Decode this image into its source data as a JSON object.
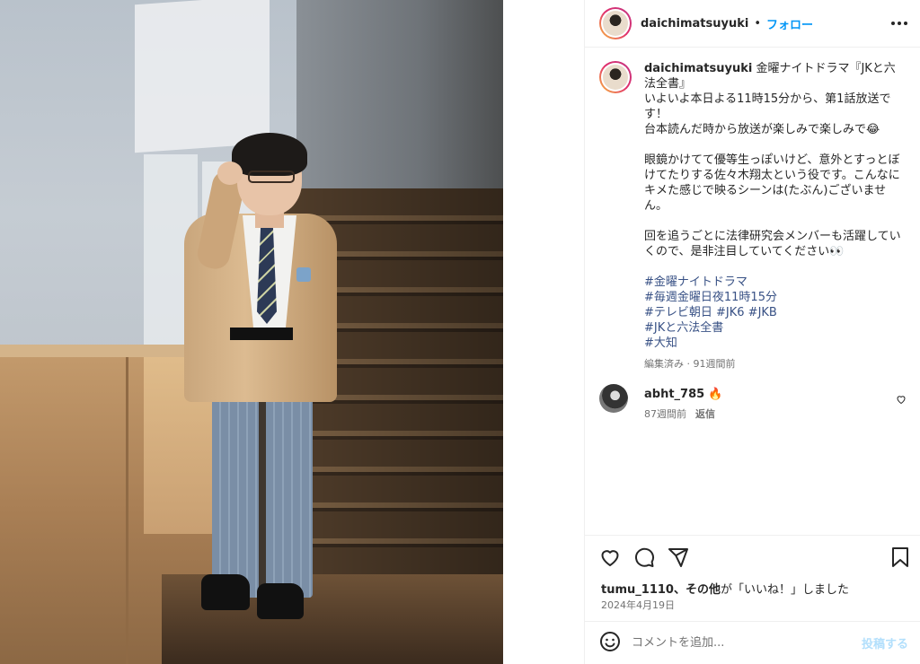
{
  "header": {
    "username": "daichimatsuyuki",
    "separator": "•",
    "follow_label": "フォロー",
    "more_icon": "more-horizontal-icon"
  },
  "caption": {
    "username": "daichimatsuyuki",
    "lines": [
      "金曜ナイトドラマ『JKと六法全書』",
      "いよいよ本日よる11時15分から、第1話放送です！",
      "台本読んだ時から放送が楽しみで楽しみで😂",
      "",
      "眼鏡かけてて優等生っぽいけど、意外とすっとぼけてたりする佐々木翔太という役です。こんなにキメた感じで映るシーンは(たぶん)ございません。",
      "",
      "回を追うごとに法律研究会メンバーも活躍していくので、是非注目していてください👀"
    ],
    "hashtags": [
      "#金曜ナイトドラマ",
      "#毎週金曜日夜11時15分",
      "#テレビ朝日 #JK6 #JKB",
      "#JKと六法全書",
      "#大知"
    ],
    "meta": "編集済み · 91週間前"
  },
  "comment": {
    "username": "abht_785",
    "text": "🔥",
    "time": "87週間前",
    "reply_label": "返信"
  },
  "likes": {
    "user": "tumu_1110",
    "others": "、その他",
    "suffix": "が「いいね！」しました"
  },
  "date": "2024年4月19日",
  "add_comment": {
    "placeholder": "コメントを追加...",
    "post_label": "投稿する"
  },
  "colors": {
    "accent": "#0095f6",
    "hashtag": "#385185",
    "muted": "#737373",
    "post_disabled": "#b2dffc"
  }
}
